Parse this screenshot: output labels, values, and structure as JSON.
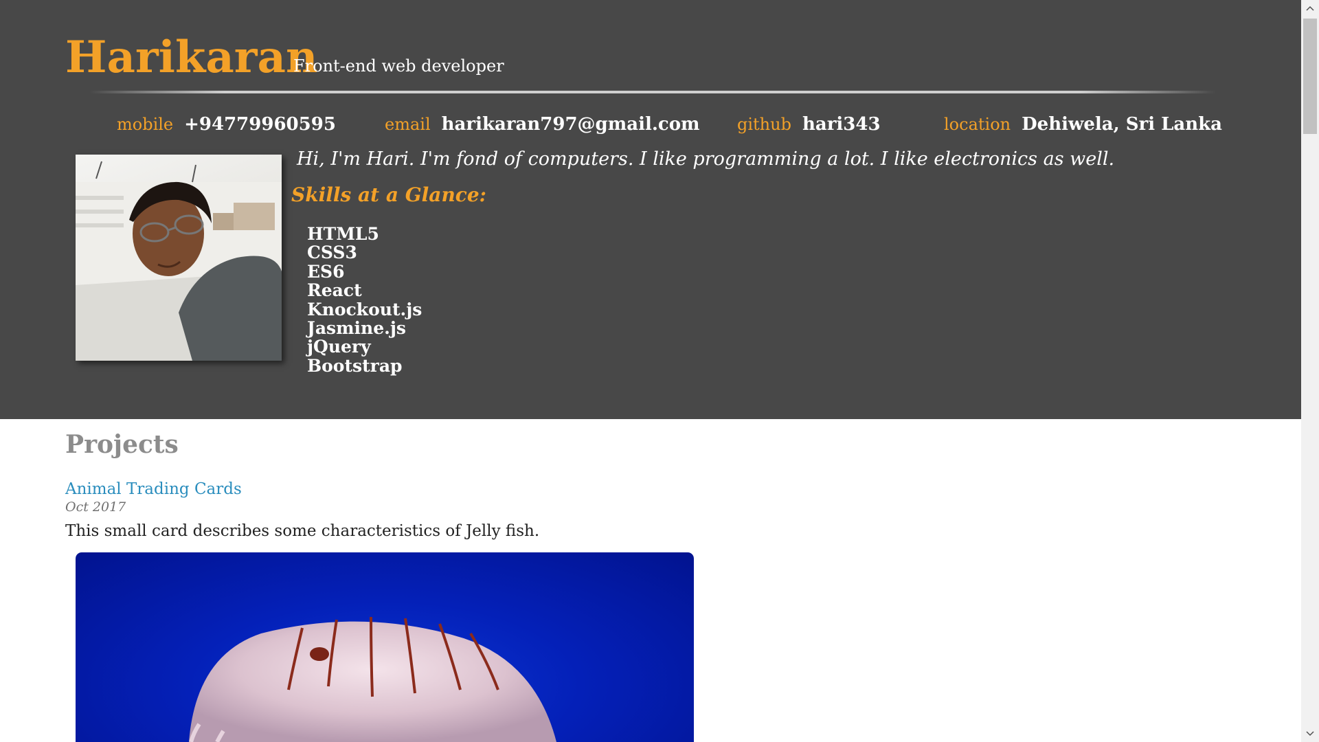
{
  "header": {
    "name": "Harikaran",
    "role": "Front-end web developer",
    "contacts": [
      {
        "label": "mobile",
        "value": "+94779960595"
      },
      {
        "label": "email",
        "value": "harikaran797@gmail.com"
      },
      {
        "label": "github",
        "value": "hari343"
      },
      {
        "label": "location",
        "value": "Dehiwela, Sri Lanka"
      }
    ],
    "intro": "Hi, I'm Hari. I'm fond of computers. I like programming a lot. I like electronics as well.",
    "skills_title": "Skills at a Glance:",
    "skills": [
      "HTML5",
      "CSS3",
      "ES6",
      "React",
      "Knockout.js",
      "Jasmine.js",
      "jQuery",
      "Bootstrap"
    ]
  },
  "projects": {
    "title": "Projects",
    "items": [
      {
        "name": "Animal Trading Cards",
        "date": "Oct 2017",
        "description": "This small card describes some characteristics of Jelly fish."
      }
    ]
  },
  "colors": {
    "header_bg": "#484848",
    "accent": "#f3a128",
    "link": "#2a8dbd",
    "section_title": "#8c8c8c"
  }
}
